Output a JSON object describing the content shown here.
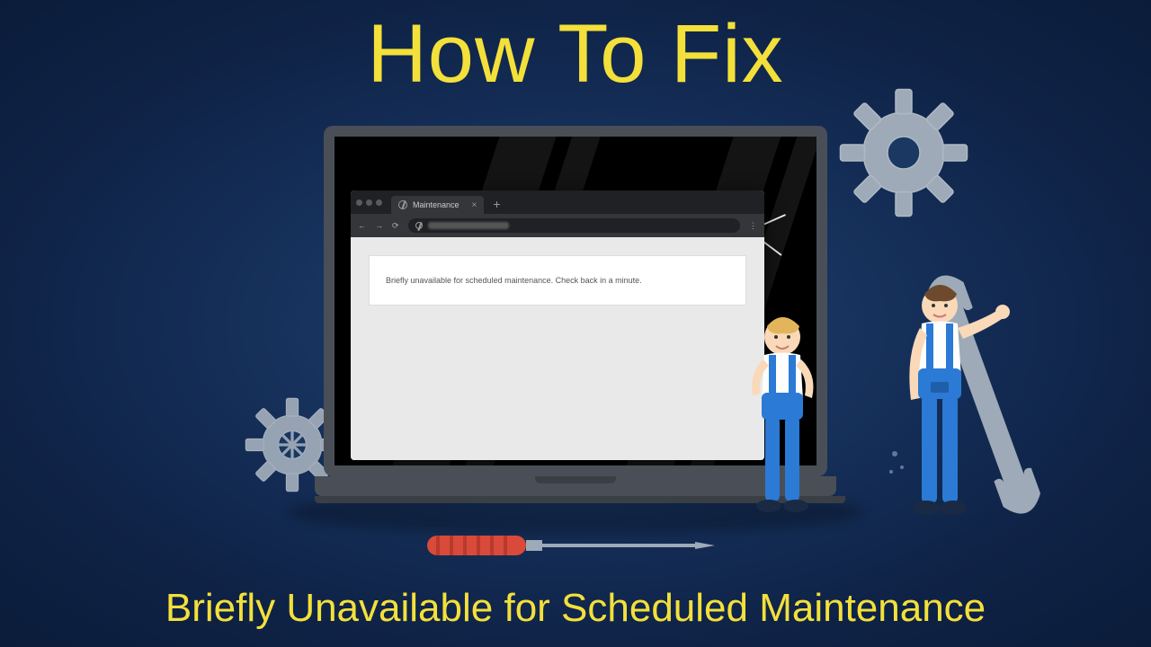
{
  "heading": {
    "top": "How To Fix",
    "bottom": "Briefly Unavailable for Scheduled Maintenance"
  },
  "browser": {
    "tab_label": "Maintenance",
    "message": "Briefly unavailable for scheduled maintenance. Check back in a minute."
  },
  "colors": {
    "accent_yellow": "#f3e03a",
    "bg_dark": "#0f2347",
    "gear_gray": "#b0bac5",
    "worker_blue": "#2b7ad6",
    "screwdriver_red": "#d94a3a"
  }
}
